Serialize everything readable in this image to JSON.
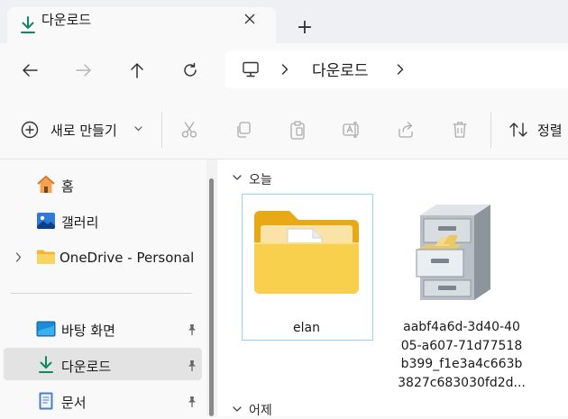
{
  "tab": {
    "title": "다운로드",
    "close_icon": "close-icon",
    "new_tab_symbol": "+"
  },
  "nav_buttons": [
    "back-arrow-icon",
    "forward-arrow-icon",
    "up-arrow-icon",
    "refresh-icon"
  ],
  "address": {
    "location": "다운로드",
    "icon": "this-pc-icon"
  },
  "commandbar": {
    "new_label": "새로 만들기",
    "sort_label": "정렬",
    "tools": [
      "cut-icon",
      "copy-icon",
      "paste-icon",
      "rename-icon",
      "share-icon",
      "delete-icon"
    ]
  },
  "sidebar": {
    "items": [
      {
        "label": "홈",
        "icon": "home-icon"
      },
      {
        "label": "갤러리",
        "icon": "gallery-icon"
      },
      {
        "label": "OneDrive - Personal",
        "icon": "onedrive-folder-icon"
      },
      {
        "label": "바탕 화면",
        "icon": "desktop-icon",
        "pinned": true
      },
      {
        "label": "다운로드",
        "icon": "download-icon",
        "pinned": true,
        "selected": true
      },
      {
        "label": "문서",
        "icon": "documents-icon",
        "pinned": true
      }
    ]
  },
  "content": {
    "groups": [
      "오늘",
      "어제"
    ],
    "files": [
      {
        "name": "elan",
        "icon": "folder-icon",
        "selected": true
      },
      {
        "name_lines": [
          "aabf4a6d-3d40-40",
          "05-a607-71d77518",
          "b399_f1e3a4c663b",
          "3827c683030fd2d..."
        ],
        "icon": "file-cabinet-icon"
      }
    ]
  },
  "colors": {
    "accent": "#0f7a5a",
    "selection_border": "#99d1ff",
    "sidebar_selected": "#e3e3e3",
    "folder": "#f5c342"
  }
}
